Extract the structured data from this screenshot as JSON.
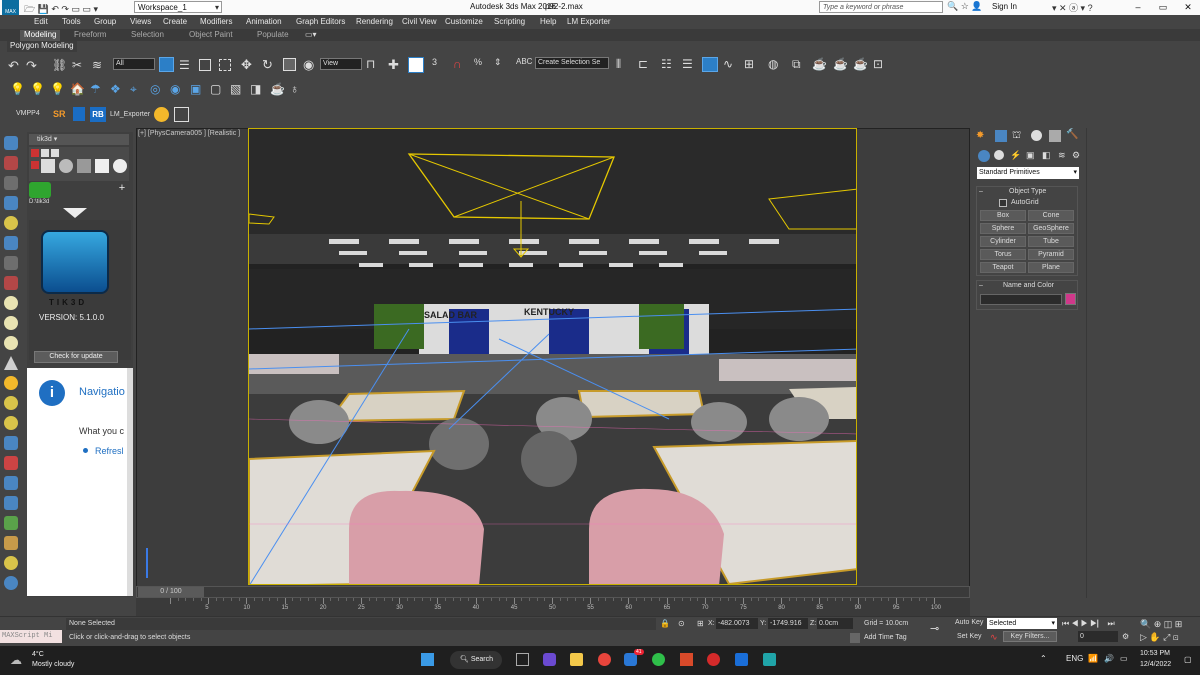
{
  "titlebar": {
    "workspace": "Workspace_1",
    "app_title": "Autodesk 3ds Max 2016",
    "file_name": "p92-2.max",
    "search_placeholder": "Type a keyword or phrase",
    "sign_in": "Sign In",
    "logo_text": "MAX"
  },
  "menu": [
    "Edit",
    "Tools",
    "Group",
    "Views",
    "Create",
    "Modifiers",
    "Animation",
    "Graph Editors",
    "Rendering",
    "Civil View",
    "Customize",
    "Scripting",
    "Help",
    "LM Exporter"
  ],
  "ribbon": {
    "tabs": [
      "Modeling",
      "Freeform",
      "Selection",
      "Object Paint",
      "Populate"
    ],
    "active": "Modeling",
    "sub_tab": "Polygon Modeling"
  },
  "toolbar": {
    "selection_filter": "All",
    "ref_coord": "View",
    "named_selection": "Create Selection Se",
    "snap_label": "3"
  },
  "plugin_bar": {
    "vmpp": "VMPP4",
    "sr": "SR",
    "rb": "RB",
    "lm_exporter": "LM_Exporter"
  },
  "tik3d": {
    "dropdown": "tik3d",
    "path": "D:\\tik3d",
    "brand": "TIK3D",
    "version": "VERSION:  5.1.0.0",
    "update_button": "Check for update",
    "nav_title": "Navigatio",
    "nav_text": "What you c",
    "nav_link": "Refresl"
  },
  "viewport": {
    "label": "[+] [PhysCamera005 ] [Realistic ]",
    "signs": {
      "salad": "SALAD BAR",
      "kentucky": "KENTUCKY"
    }
  },
  "command_panel": {
    "category": "Standard Primitives",
    "object_type_header": "Object Type",
    "autogrid": "AutoGrid",
    "buttons": [
      "Box",
      "Cone",
      "Sphere",
      "GeoSphere",
      "Cylinder",
      "Tube",
      "Torus",
      "Pyramid",
      "Teapot",
      "Plane"
    ],
    "name_color_header": "Name and Color",
    "color": "#d0388a"
  },
  "timeline": {
    "frame": "0 / 100",
    "ticks": [
      "0",
      "5",
      "10",
      "15",
      "20",
      "25",
      "30",
      "35",
      "40",
      "45",
      "50",
      "55",
      "60",
      "65",
      "70",
      "75",
      "80",
      "85",
      "90",
      "95",
      "100"
    ]
  },
  "status": {
    "maxscript": "MAXScript Mi",
    "selection": "None Selected",
    "prompt": "Click or click-and-drag to select objects",
    "x_label": "X:",
    "x": "-482.0073",
    "y_label": "Y:",
    "y": "-1749.916",
    "z_label": "Z:",
    "z": "0.0cm",
    "grid": "Grid = 10.0cm",
    "add_time_tag": "Add Time Tag",
    "auto_key": "Auto Key",
    "set_key": "Set Key",
    "selected": "Selected",
    "key_filters": "Key Filters...",
    "frame_value": "0"
  },
  "taskbar": {
    "temp": "4°C",
    "weather": "Mostly cloudy",
    "search": "Search",
    "time": "10:53 PM",
    "date": "12/4/2022",
    "badge": "41",
    "lang": "ENG"
  }
}
